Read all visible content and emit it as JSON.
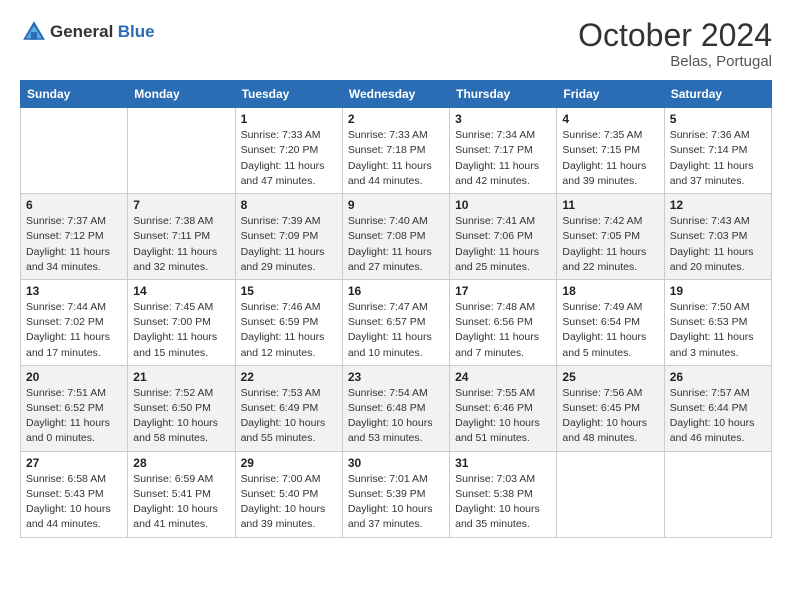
{
  "header": {
    "logo_line1": "General",
    "logo_line2": "Blue",
    "month_title": "October 2024",
    "location": "Belas, Portugal"
  },
  "days_of_week": [
    "Sunday",
    "Monday",
    "Tuesday",
    "Wednesday",
    "Thursday",
    "Friday",
    "Saturday"
  ],
  "weeks": [
    [
      {
        "day": "",
        "sunrise": "",
        "sunset": "",
        "daylight": ""
      },
      {
        "day": "",
        "sunrise": "",
        "sunset": "",
        "daylight": ""
      },
      {
        "day": "1",
        "sunrise": "Sunrise: 7:33 AM",
        "sunset": "Sunset: 7:20 PM",
        "daylight": "Daylight: 11 hours and 47 minutes."
      },
      {
        "day": "2",
        "sunrise": "Sunrise: 7:33 AM",
        "sunset": "Sunset: 7:18 PM",
        "daylight": "Daylight: 11 hours and 44 minutes."
      },
      {
        "day": "3",
        "sunrise": "Sunrise: 7:34 AM",
        "sunset": "Sunset: 7:17 PM",
        "daylight": "Daylight: 11 hours and 42 minutes."
      },
      {
        "day": "4",
        "sunrise": "Sunrise: 7:35 AM",
        "sunset": "Sunset: 7:15 PM",
        "daylight": "Daylight: 11 hours and 39 minutes."
      },
      {
        "day": "5",
        "sunrise": "Sunrise: 7:36 AM",
        "sunset": "Sunset: 7:14 PM",
        "daylight": "Daylight: 11 hours and 37 minutes."
      }
    ],
    [
      {
        "day": "6",
        "sunrise": "Sunrise: 7:37 AM",
        "sunset": "Sunset: 7:12 PM",
        "daylight": "Daylight: 11 hours and 34 minutes."
      },
      {
        "day": "7",
        "sunrise": "Sunrise: 7:38 AM",
        "sunset": "Sunset: 7:11 PM",
        "daylight": "Daylight: 11 hours and 32 minutes."
      },
      {
        "day": "8",
        "sunrise": "Sunrise: 7:39 AM",
        "sunset": "Sunset: 7:09 PM",
        "daylight": "Daylight: 11 hours and 29 minutes."
      },
      {
        "day": "9",
        "sunrise": "Sunrise: 7:40 AM",
        "sunset": "Sunset: 7:08 PM",
        "daylight": "Daylight: 11 hours and 27 minutes."
      },
      {
        "day": "10",
        "sunrise": "Sunrise: 7:41 AM",
        "sunset": "Sunset: 7:06 PM",
        "daylight": "Daylight: 11 hours and 25 minutes."
      },
      {
        "day": "11",
        "sunrise": "Sunrise: 7:42 AM",
        "sunset": "Sunset: 7:05 PM",
        "daylight": "Daylight: 11 hours and 22 minutes."
      },
      {
        "day": "12",
        "sunrise": "Sunrise: 7:43 AM",
        "sunset": "Sunset: 7:03 PM",
        "daylight": "Daylight: 11 hours and 20 minutes."
      }
    ],
    [
      {
        "day": "13",
        "sunrise": "Sunrise: 7:44 AM",
        "sunset": "Sunset: 7:02 PM",
        "daylight": "Daylight: 11 hours and 17 minutes."
      },
      {
        "day": "14",
        "sunrise": "Sunrise: 7:45 AM",
        "sunset": "Sunset: 7:00 PM",
        "daylight": "Daylight: 11 hours and 15 minutes."
      },
      {
        "day": "15",
        "sunrise": "Sunrise: 7:46 AM",
        "sunset": "Sunset: 6:59 PM",
        "daylight": "Daylight: 11 hours and 12 minutes."
      },
      {
        "day": "16",
        "sunrise": "Sunrise: 7:47 AM",
        "sunset": "Sunset: 6:57 PM",
        "daylight": "Daylight: 11 hours and 10 minutes."
      },
      {
        "day": "17",
        "sunrise": "Sunrise: 7:48 AM",
        "sunset": "Sunset: 6:56 PM",
        "daylight": "Daylight: 11 hours and 7 minutes."
      },
      {
        "day": "18",
        "sunrise": "Sunrise: 7:49 AM",
        "sunset": "Sunset: 6:54 PM",
        "daylight": "Daylight: 11 hours and 5 minutes."
      },
      {
        "day": "19",
        "sunrise": "Sunrise: 7:50 AM",
        "sunset": "Sunset: 6:53 PM",
        "daylight": "Daylight: 11 hours and 3 minutes."
      }
    ],
    [
      {
        "day": "20",
        "sunrise": "Sunrise: 7:51 AM",
        "sunset": "Sunset: 6:52 PM",
        "daylight": "Daylight: 11 hours and 0 minutes."
      },
      {
        "day": "21",
        "sunrise": "Sunrise: 7:52 AM",
        "sunset": "Sunset: 6:50 PM",
        "daylight": "Daylight: 10 hours and 58 minutes."
      },
      {
        "day": "22",
        "sunrise": "Sunrise: 7:53 AM",
        "sunset": "Sunset: 6:49 PM",
        "daylight": "Daylight: 10 hours and 55 minutes."
      },
      {
        "day": "23",
        "sunrise": "Sunrise: 7:54 AM",
        "sunset": "Sunset: 6:48 PM",
        "daylight": "Daylight: 10 hours and 53 minutes."
      },
      {
        "day": "24",
        "sunrise": "Sunrise: 7:55 AM",
        "sunset": "Sunset: 6:46 PM",
        "daylight": "Daylight: 10 hours and 51 minutes."
      },
      {
        "day": "25",
        "sunrise": "Sunrise: 7:56 AM",
        "sunset": "Sunset: 6:45 PM",
        "daylight": "Daylight: 10 hours and 48 minutes."
      },
      {
        "day": "26",
        "sunrise": "Sunrise: 7:57 AM",
        "sunset": "Sunset: 6:44 PM",
        "daylight": "Daylight: 10 hours and 46 minutes."
      }
    ],
    [
      {
        "day": "27",
        "sunrise": "Sunrise: 6:58 AM",
        "sunset": "Sunset: 5:43 PM",
        "daylight": "Daylight: 10 hours and 44 minutes."
      },
      {
        "day": "28",
        "sunrise": "Sunrise: 6:59 AM",
        "sunset": "Sunset: 5:41 PM",
        "daylight": "Daylight: 10 hours and 41 minutes."
      },
      {
        "day": "29",
        "sunrise": "Sunrise: 7:00 AM",
        "sunset": "Sunset: 5:40 PM",
        "daylight": "Daylight: 10 hours and 39 minutes."
      },
      {
        "day": "30",
        "sunrise": "Sunrise: 7:01 AM",
        "sunset": "Sunset: 5:39 PM",
        "daylight": "Daylight: 10 hours and 37 minutes."
      },
      {
        "day": "31",
        "sunrise": "Sunrise: 7:03 AM",
        "sunset": "Sunset: 5:38 PM",
        "daylight": "Daylight: 10 hours and 35 minutes."
      },
      {
        "day": "",
        "sunrise": "",
        "sunset": "",
        "daylight": ""
      },
      {
        "day": "",
        "sunrise": "",
        "sunset": "",
        "daylight": ""
      }
    ]
  ]
}
